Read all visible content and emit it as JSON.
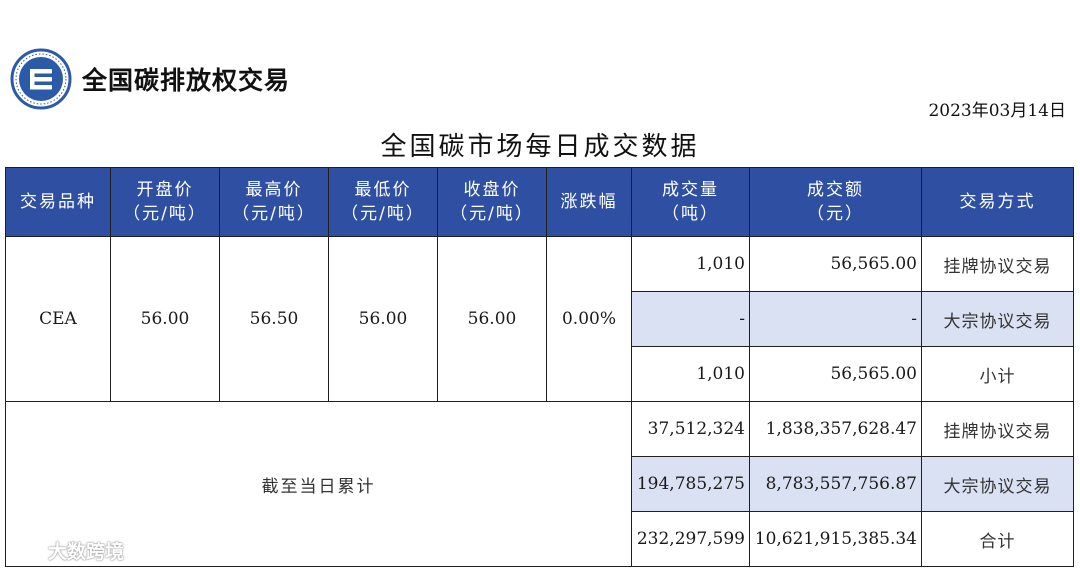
{
  "header": {
    "brand": "全国碳排放权交易",
    "date": "2023年03月14日",
    "title": "全国碳市场每日成交数据"
  },
  "table": {
    "columns": [
      {
        "line1": "交易品种",
        "line2": ""
      },
      {
        "line1": "开盘价",
        "line2": "（元/吨）"
      },
      {
        "line1": "最高价",
        "line2": "（元/吨）"
      },
      {
        "line1": "最低价",
        "line2": "（元/吨）"
      },
      {
        "line1": "收盘价",
        "line2": "（元/吨）"
      },
      {
        "line1": "涨跌幅",
        "line2": ""
      },
      {
        "line1": "成交量",
        "line2": "（吨）"
      },
      {
        "line1": "成交额",
        "line2": "（元）"
      },
      {
        "line1": "交易方式",
        "line2": ""
      }
    ],
    "daily": {
      "product": "CEA",
      "open": "56.00",
      "high": "56.50",
      "low": "56.00",
      "close": "56.00",
      "change": "0.00%",
      "rows": [
        {
          "volume": "1,010",
          "amount": "56,565.00",
          "method": "挂牌协议交易"
        },
        {
          "volume": "-",
          "amount": "-",
          "method": "大宗协议交易"
        },
        {
          "volume": "1,010",
          "amount": "56,565.00",
          "method": "小计"
        }
      ]
    },
    "cumulative": {
      "label": "截至当日累计",
      "rows": [
        {
          "volume": "37,512,324",
          "amount": "1,838,357,628.47",
          "method": "挂牌协议交易"
        },
        {
          "volume": "194,785,275",
          "amount": "8,783,557,756.87",
          "method": "大宗协议交易"
        },
        {
          "volume": "232,297,599",
          "amount": "10,621,915,385.34",
          "method": "合计"
        }
      ]
    }
  },
  "watermark": {
    "text": "大数跨境"
  },
  "colors": {
    "header_bg": "#2f4fa2",
    "highlight_bg": "#dae1f2",
    "logo_blue": "#2a5aa8"
  },
  "icons": {
    "logo": "emblem-icon",
    "watermark": "chat-bubble-icon"
  }
}
